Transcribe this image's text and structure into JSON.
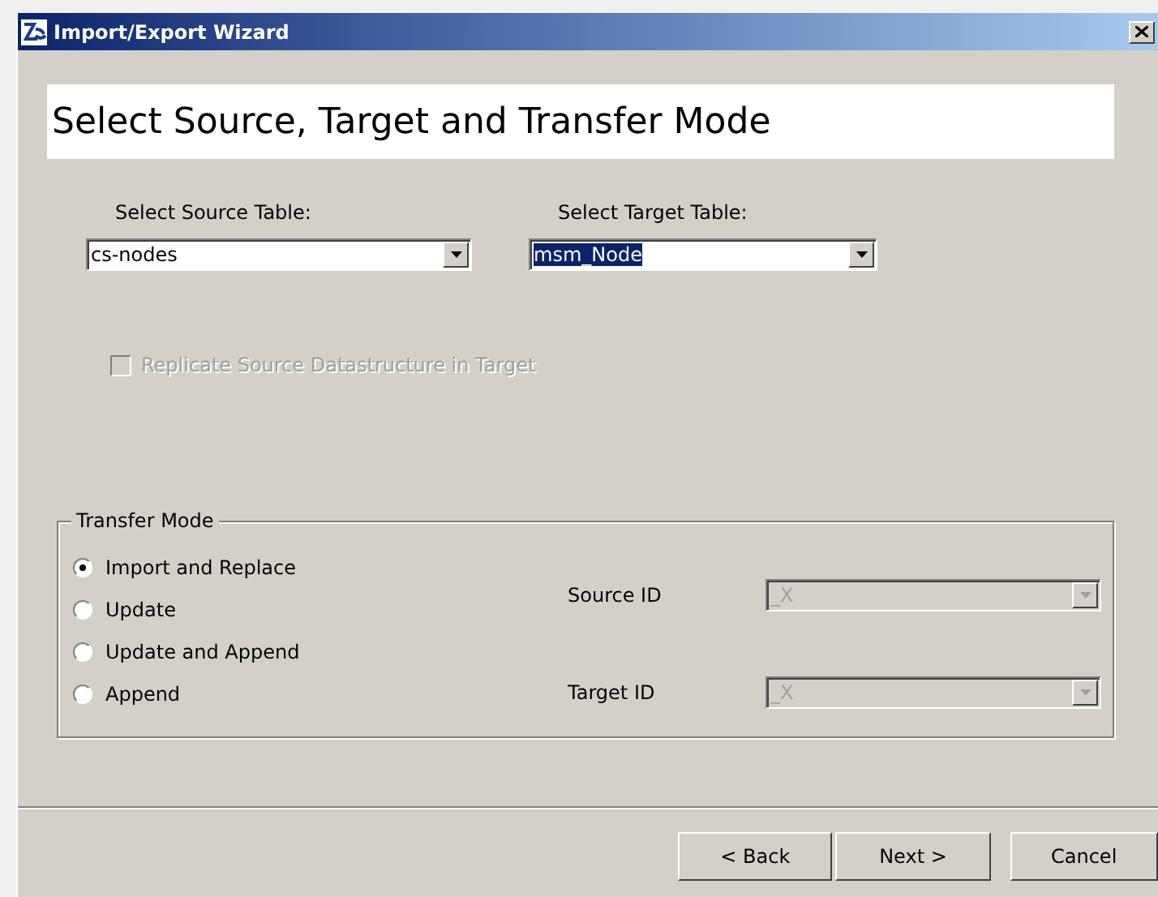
{
  "window": {
    "title": "Import/Export Wizard"
  },
  "heading": "Select Source, Target and Transfer Mode",
  "source_table": {
    "label": "Select Source Table:",
    "value": "cs-nodes",
    "highlighted": false
  },
  "target_table": {
    "label": "Select Target Table:",
    "value": "msm_Node",
    "highlighted": true
  },
  "replicate": {
    "label": "Replicate Source Datastructure in Target",
    "checked": false,
    "disabled": true
  },
  "transfer_mode": {
    "title": "Transfer Mode",
    "options": [
      {
        "label": "Import and Replace",
        "selected": true
      },
      {
        "label": "Update",
        "selected": false
      },
      {
        "label": "Update and Append",
        "selected": false
      },
      {
        "label": "Append",
        "selected": false
      }
    ],
    "fields": [
      {
        "label": "Source ID",
        "value": "_X",
        "disabled": true
      },
      {
        "label": "Target ID",
        "value": "_X",
        "disabled": true
      }
    ]
  },
  "buttons": [
    {
      "label": "< Back"
    },
    {
      "label": "Next >"
    },
    {
      "label": "Cancel"
    }
  ]
}
